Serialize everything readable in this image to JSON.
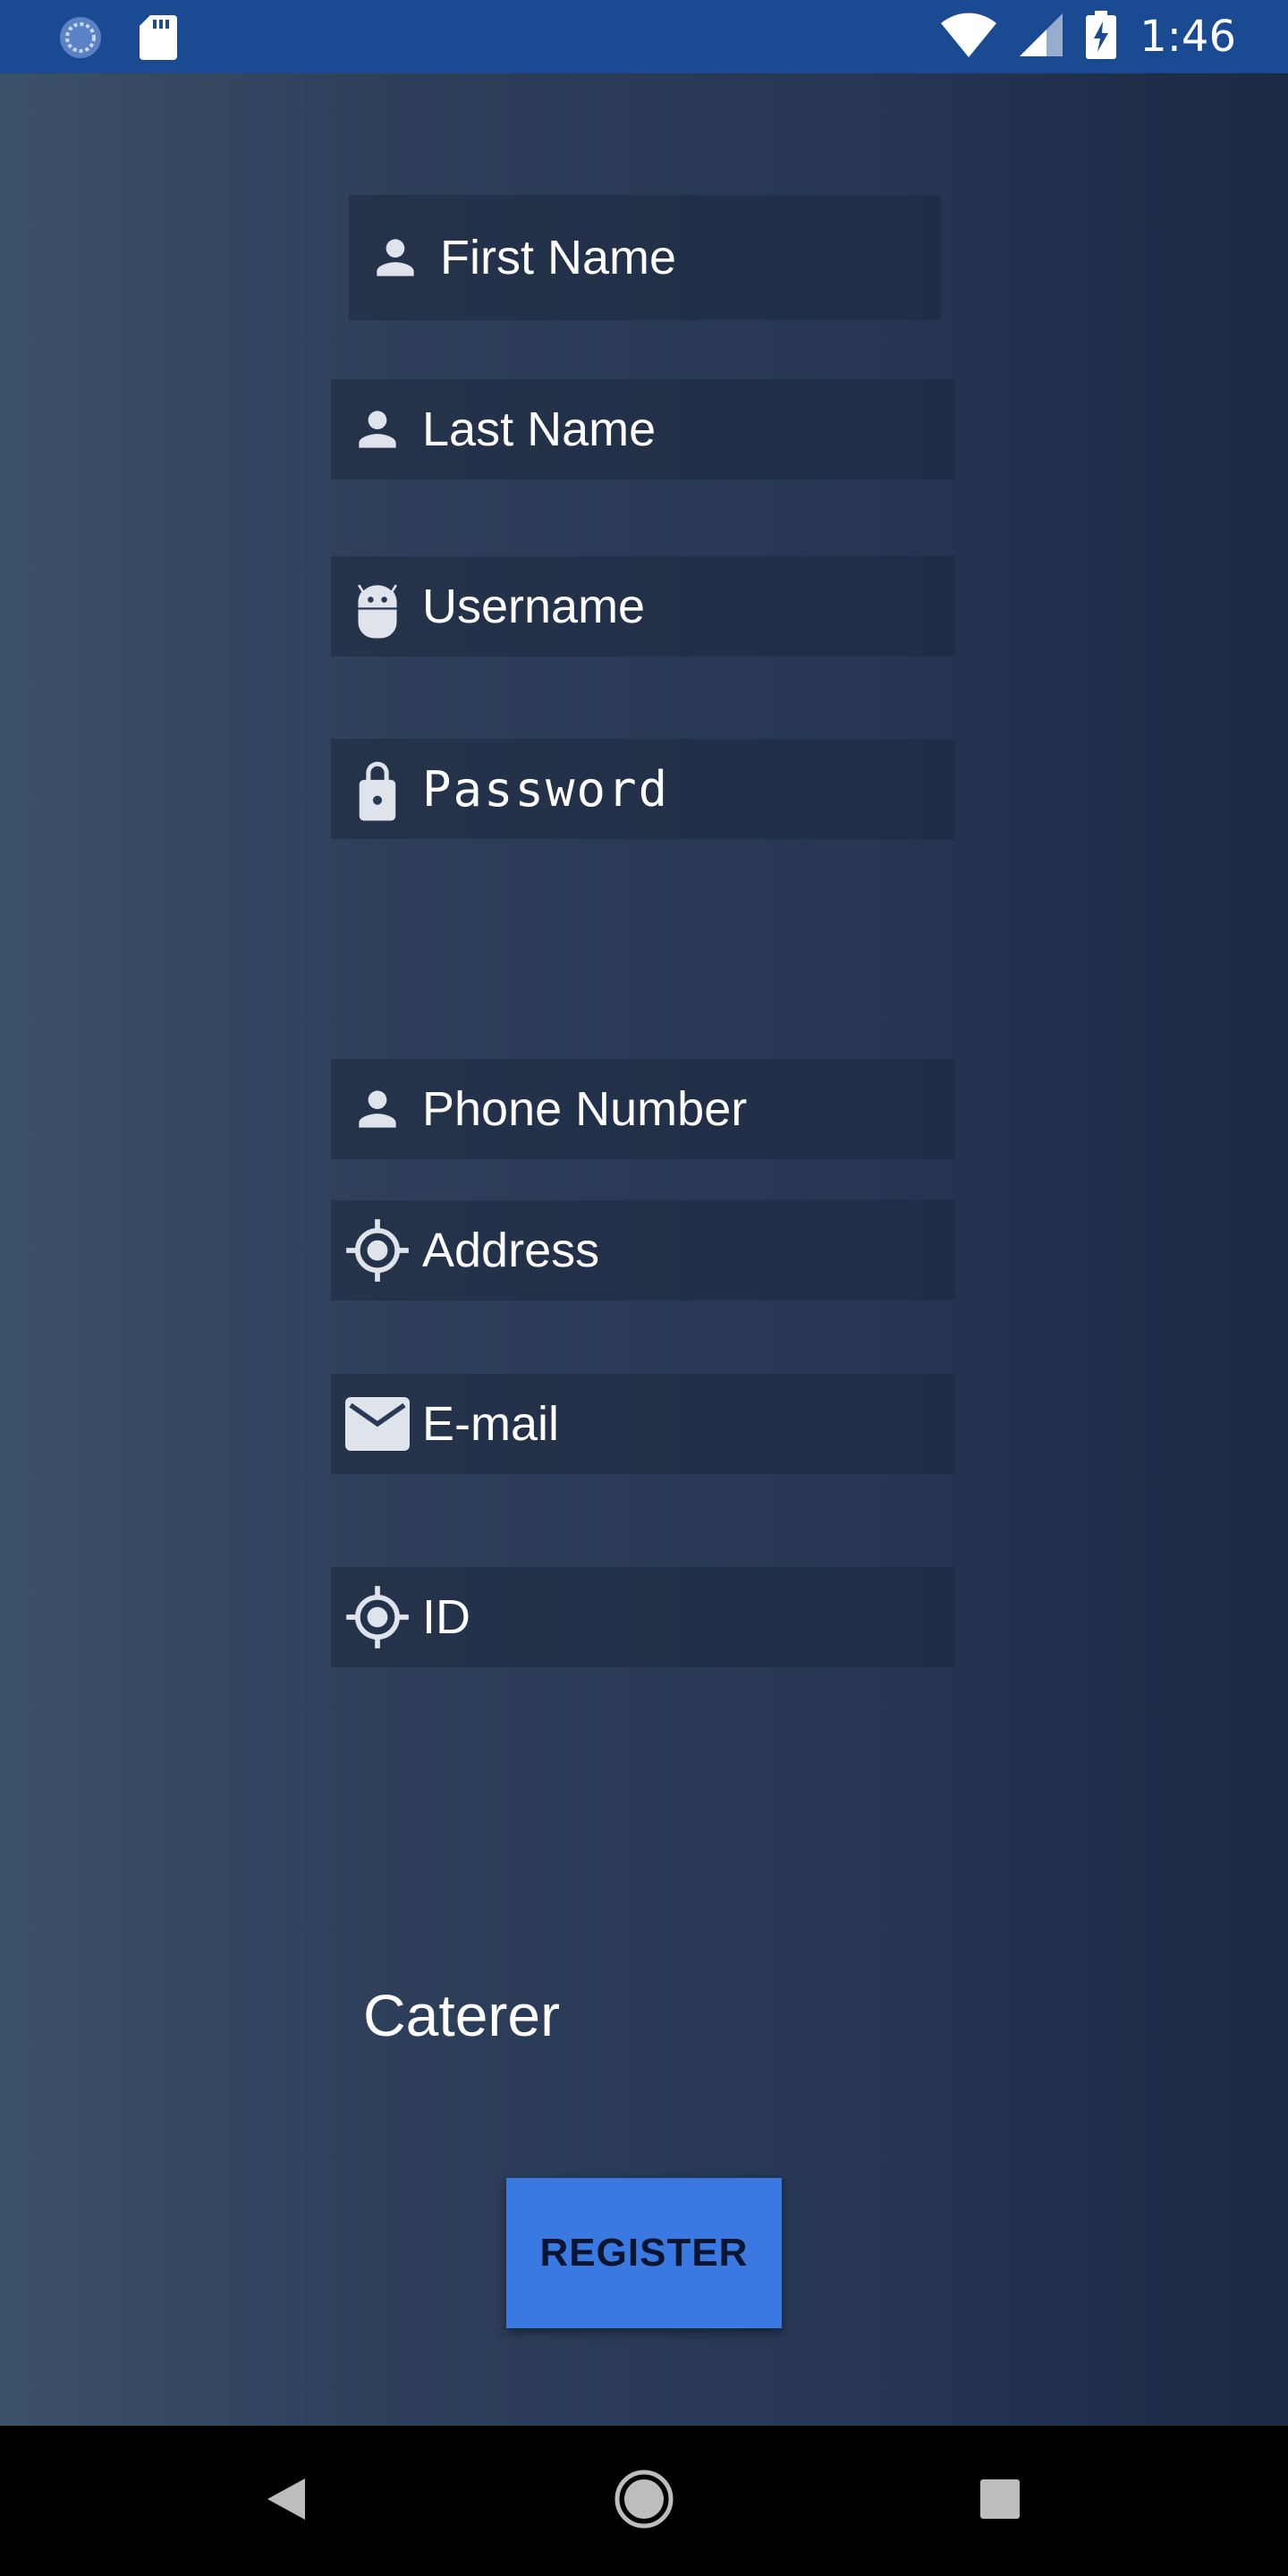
{
  "status_bar": {
    "time": "1:46",
    "icons": [
      "sync-icon",
      "sd-card-icon",
      "wifi-icon",
      "cell-signal-icon",
      "battery-charging-icon"
    ]
  },
  "form": {
    "first_name": {
      "placeholder": "First Name",
      "icon": "person-icon"
    },
    "last_name": {
      "placeholder": "Last Name",
      "icon": "person-icon"
    },
    "username": {
      "placeholder": "Username",
      "icon": "android-icon"
    },
    "password": {
      "placeholder": "Password",
      "icon": "lock-icon"
    },
    "phone": {
      "placeholder": "Phone Number",
      "icon": "person-icon"
    },
    "address": {
      "placeholder": "Address",
      "icon": "location-target-icon"
    },
    "email": {
      "placeholder": "E-mail",
      "icon": "email-icon"
    },
    "id": {
      "placeholder": "ID",
      "icon": "location-target-icon"
    }
  },
  "role": "Caterer",
  "register_label": "REGISTER",
  "nav": {
    "icons": [
      "back-icon",
      "home-icon",
      "recents-icon"
    ]
  },
  "colors": {
    "status_bar": "#1a4a91",
    "button": "#3a79e2",
    "icon": "#dfe3ec"
  }
}
